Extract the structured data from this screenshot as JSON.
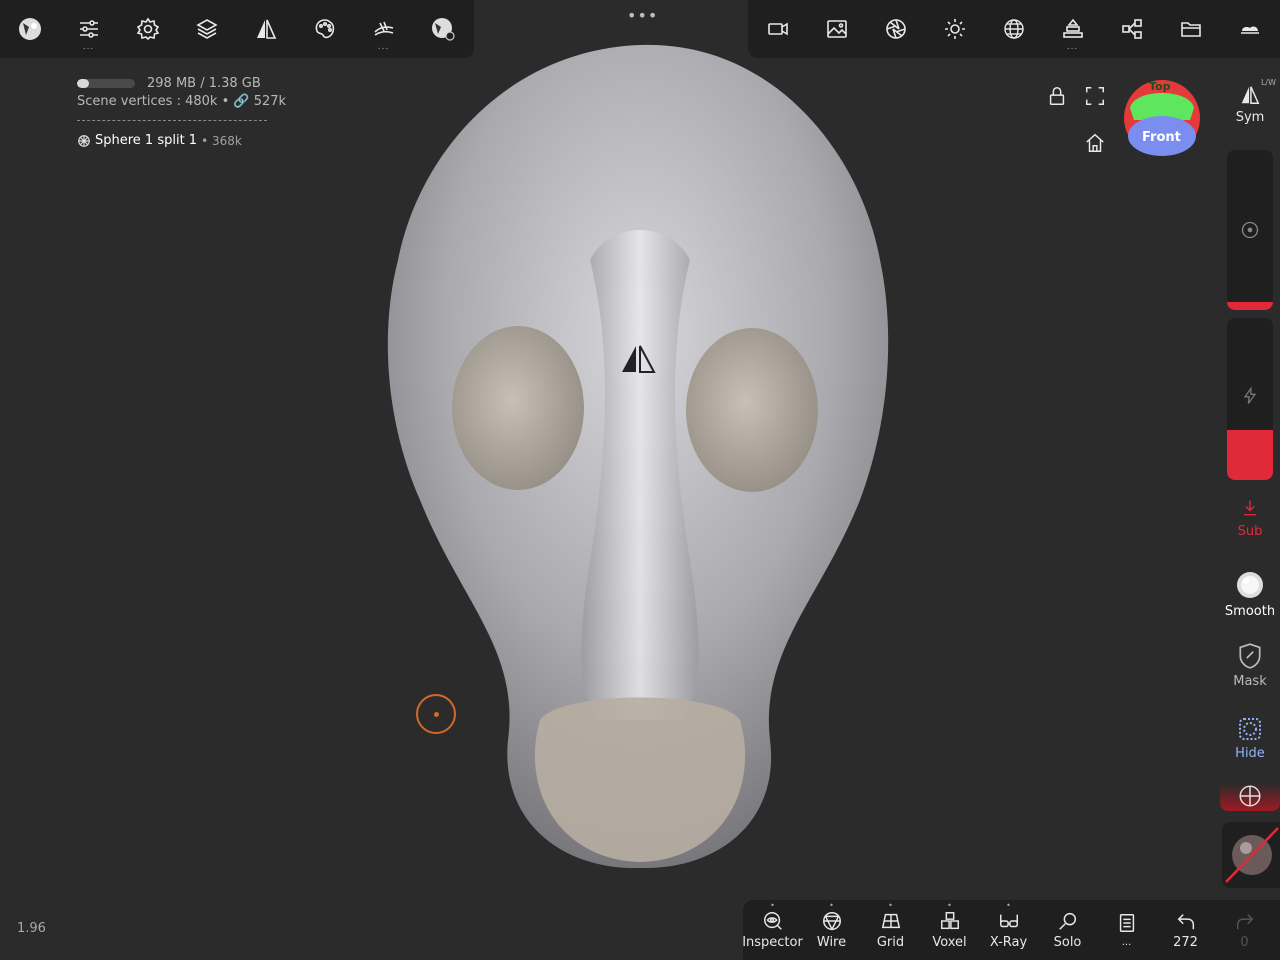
{
  "top_left_tools": [
    {
      "icon": "sphere-material-icon",
      "more": ""
    },
    {
      "icon": "sliders-icon",
      "more": "..."
    },
    {
      "icon": "gear-icon",
      "more": ""
    },
    {
      "icon": "layers-icon",
      "more": ""
    },
    {
      "icon": "symmetry-icon",
      "more": ""
    },
    {
      "icon": "palette-icon",
      "more": ""
    },
    {
      "icon": "tool-icon",
      "more": "..."
    },
    {
      "icon": "material-settings-icon",
      "more": ""
    }
  ],
  "top_right_tools": [
    {
      "icon": "camera-icon",
      "more": ""
    },
    {
      "icon": "image-icon",
      "more": ""
    },
    {
      "icon": "aperture-icon",
      "more": ""
    },
    {
      "icon": "sun-icon",
      "more": ""
    },
    {
      "icon": "globe-grid-icon",
      "more": ""
    },
    {
      "icon": "stack-icon",
      "more": "..."
    },
    {
      "icon": "share-icon",
      "more": ""
    },
    {
      "icon": "folder-icon",
      "more": ""
    },
    {
      "icon": "cloud-icon",
      "more": ""
    }
  ],
  "handle_dots": "•••",
  "info": {
    "memory": "298 MB / 1.38 GB",
    "memory_fraction": 0.21,
    "vertices_label": "Scene vertices :",
    "vertices_value": "480k •",
    "vertices_linked": "527k",
    "object_name": "Sphere 1 split 1",
    "object_count": "• 368k"
  },
  "gizmo": {
    "top": "Top",
    "front": "Front"
  },
  "side": {
    "sym_label": "Sym",
    "sym_sup": "L/W",
    "sub_label": "Sub",
    "smooth_label": "Smooth",
    "mask_label": "Mask",
    "hide_label": "Hide"
  },
  "bottom_tools": [
    {
      "icon": "inspector-icon",
      "label": "Inspector"
    },
    {
      "icon": "wire-icon",
      "label": "Wire"
    },
    {
      "icon": "grid-icon",
      "label": "Grid"
    },
    {
      "icon": "voxel-icon",
      "label": "Voxel"
    },
    {
      "icon": "xray-icon",
      "label": "X-Ray"
    },
    {
      "icon": "solo-icon",
      "label": "Solo"
    },
    {
      "icon": "notes-icon",
      "label": "..."
    },
    {
      "icon": "undo-icon",
      "label": "272"
    },
    {
      "icon": "redo-icon",
      "label": "0"
    }
  ],
  "version": "1.96",
  "colors": {
    "accent_red": "#e02a3a",
    "hide_blue": "#8fb4ff",
    "cursor": "#d2692a"
  }
}
